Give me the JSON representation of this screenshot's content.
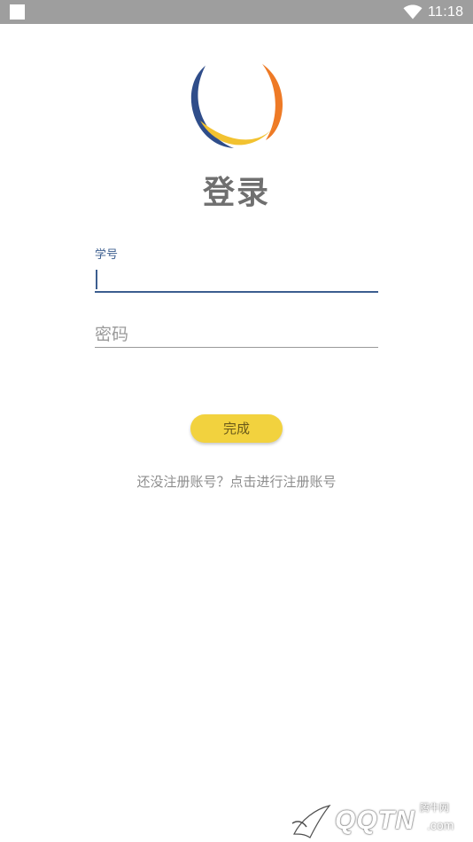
{
  "status_bar": {
    "time": "11:18",
    "wifi_icon": "wifi-icon",
    "background_color": "#9e9e9e"
  },
  "logo": {
    "icon": "ring-logo-icon",
    "colors": [
      "#2f4d8a",
      "#f2c230",
      "#ee7a26"
    ]
  },
  "title": "登录",
  "form": {
    "student_id_label": "学号",
    "student_id_value": "",
    "password_placeholder": "密码",
    "accent_color": "#3c5e8f"
  },
  "submit_button": {
    "label": "完成",
    "color": "#f2d23e"
  },
  "register_link": "还没注册账号？点击进行注册账号",
  "watermark": {
    "chinese": "腾牛网",
    "brand": "QQTN",
    "suffix": ".com",
    "icon": "leaf-logo-icon"
  }
}
